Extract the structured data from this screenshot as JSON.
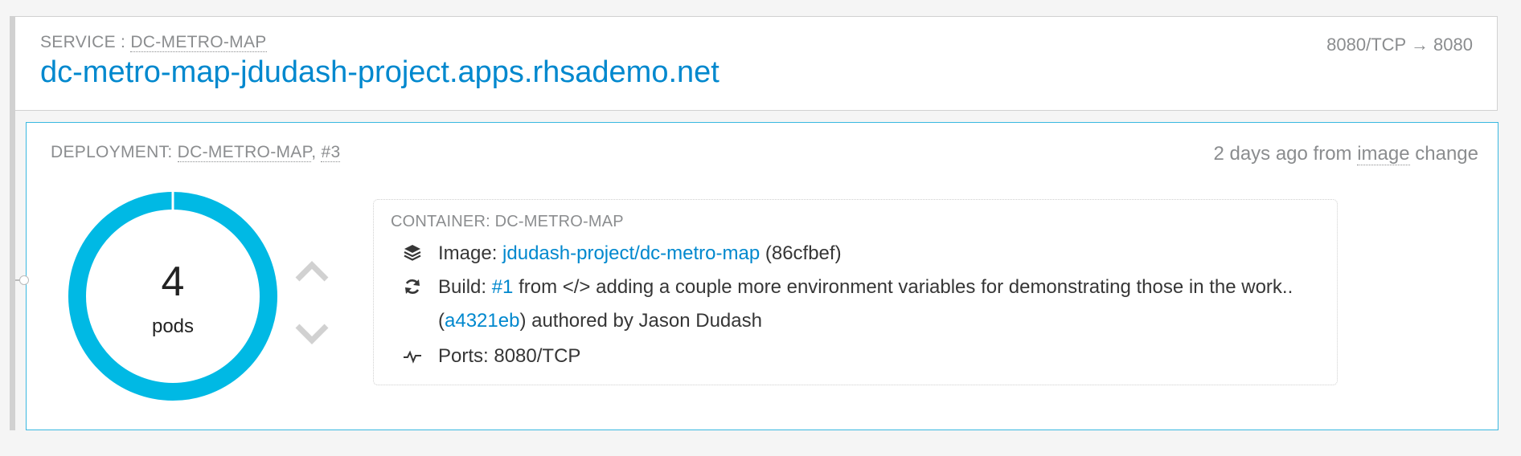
{
  "service": {
    "label_prefix": "SERVICE : ",
    "name": "DC-METRO-MAP",
    "route": "dc-metro-map-jdudash-project.apps.rhsademo.net",
    "ports": "8080/TCP → 8080"
  },
  "deployment": {
    "label_prefix": "DEPLOYMENT: ",
    "name": "DC-METRO-MAP",
    "separator": ", ",
    "version": "#3",
    "time_prefix": "2 days ago from ",
    "trigger": "image",
    "time_suffix": " change"
  },
  "pods": {
    "count": "4",
    "unit": "pods",
    "ring_color": "#00b9e4"
  },
  "container": {
    "title": "CONTAINER: DC-METRO-MAP",
    "image_label": "Image: ",
    "image_link": "jdudash-project/dc-metro-map",
    "image_hash": " (86cfbef)",
    "build_label": "Build: ",
    "build_link": "#1",
    "build_from": " from ",
    "build_code_icon": "</>",
    "build_message": " adding a couple more environment variables for demonstrating those in the work.. (",
    "commit_link": "a4321eb",
    "build_author": ") authored by Jason Dudash",
    "ports_label": "Ports: ",
    "ports_value": "8080/TCP"
  },
  "icons": {
    "image": "layers-icon",
    "build": "refresh-icon",
    "ports": "pulse-icon",
    "scale_up": "chevron-up-icon",
    "scale_down": "chevron-down-icon"
  }
}
